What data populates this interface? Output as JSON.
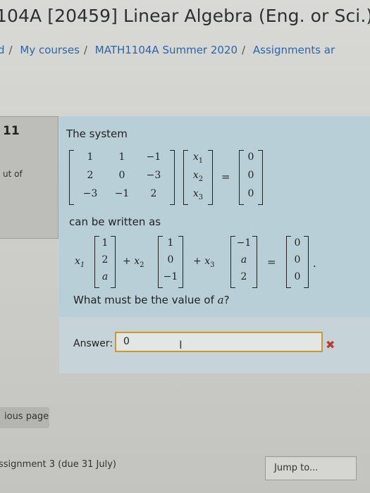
{
  "header": {
    "course_title": "104A [20459] Linear Algebra (Eng. or Sci.)"
  },
  "breadcrumb": {
    "items": [
      "d",
      "My courses",
      "MATH1104A Summer 2020",
      "Assignments ar"
    ],
    "separator": "/"
  },
  "question_info": {
    "number": "11",
    "mark_text": "ut of"
  },
  "question": {
    "intro": "The system",
    "coefficient_matrix": [
      [
        "1",
        "1",
        "−1"
      ],
      [
        "2",
        "0",
        "−3"
      ],
      [
        "−3",
        "−1",
        "2"
      ]
    ],
    "variable_vector": [
      "x",
      "x",
      "x"
    ],
    "variable_subscripts": [
      "1",
      "2",
      "3"
    ],
    "rhs_vector": [
      "0",
      "0",
      "0"
    ],
    "equals": "=",
    "middle_text": "can be written as",
    "vec1": [
      "1",
      "2",
      "a"
    ],
    "vec2": [
      "1",
      "0",
      "−1"
    ],
    "vec3": [
      "−1",
      "a",
      "2"
    ],
    "zero_vec": [
      "0",
      "0",
      "0"
    ],
    "plus": "+",
    "period": ".",
    "prompt_prefix": "What must be the value of",
    "prompt_var": "a",
    "prompt_suffix": "?"
  },
  "answer": {
    "label": "Answer:",
    "value": "0",
    "cursor_glyph": "I",
    "result_mark": "✖"
  },
  "navigation": {
    "previous_label": "ious page",
    "next_activity": "ssignment 3 (due 31 July)",
    "jump_label": "Jump to..."
  },
  "colors": {
    "question_panel": "#b9cfd8",
    "answer_panel": "#c6d3d8",
    "input_border": "#c89a2c",
    "incorrect": "#c0392b",
    "link": "#2a66a8"
  }
}
